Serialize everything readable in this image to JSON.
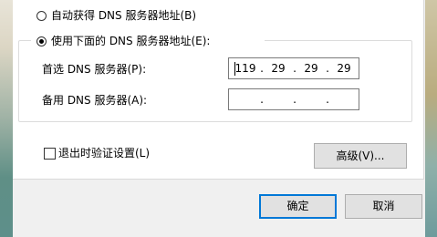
{
  "dns": {
    "auto_label": "自动获得 DNS 服务器地址(B)",
    "manual_label": "使用下面的 DNS 服务器地址(E):",
    "preferred_label": "首选 DNS 服务器(P):",
    "alternate_label": "备用 DNS 服务器(A):",
    "preferred": [
      "119",
      "29",
      "29",
      "29"
    ],
    "alternate": [
      "",
      "",
      "",
      ""
    ],
    "selected": "manual"
  },
  "options": {
    "validate_label": "退出时验证设置(L)",
    "validate_checked": false,
    "advanced_label": "高级(V)..."
  },
  "footer": {
    "ok_label": "确定",
    "cancel_label": "取消"
  }
}
